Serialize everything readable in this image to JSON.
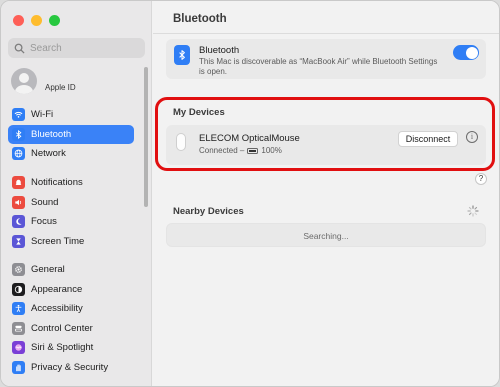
{
  "window": {
    "title": "Bluetooth",
    "traffic_lights": [
      "close",
      "minimize",
      "zoom"
    ]
  },
  "sidebar": {
    "search_placeholder": "Search",
    "profile": {
      "name": "",
      "subtitle": "Apple ID"
    },
    "groups": [
      [
        {
          "label": "Wi-Fi",
          "icon": "wifi-icon",
          "color": "#2f7ef5"
        },
        {
          "label": "Bluetooth",
          "icon": "bluetooth-icon",
          "color": "#2f7ef5",
          "active": true
        },
        {
          "label": "Network",
          "icon": "globe-icon",
          "color": "#2f7ef5"
        }
      ],
      [
        {
          "label": "Notifications",
          "icon": "bell-icon",
          "color": "#ec4b3f"
        },
        {
          "label": "Sound",
          "icon": "speaker-icon",
          "color": "#ec4b3f"
        },
        {
          "label": "Focus",
          "icon": "moon-icon",
          "color": "#5b56d6"
        },
        {
          "label": "Screen Time",
          "icon": "hourglass-icon",
          "color": "#5b56d6"
        }
      ],
      [
        {
          "label": "General",
          "icon": "gear-icon",
          "color": "#8e8e93"
        },
        {
          "label": "Appearance",
          "icon": "appearance-icon",
          "color": "#1d1d1f"
        },
        {
          "label": "Accessibility",
          "icon": "accessibility-icon",
          "color": "#2f7ef5"
        },
        {
          "label": "Control Center",
          "icon": "control-center-icon",
          "color": "#8e8e93"
        },
        {
          "label": "Siri & Spotlight",
          "icon": "siri-icon",
          "color": "#7a3fd6"
        },
        {
          "label": "Privacy & Security",
          "icon": "hand-icon",
          "color": "#2f7ef5"
        }
      ]
    ]
  },
  "main": {
    "title": "Bluetooth",
    "bluetooth_card": {
      "title": "Bluetooth",
      "description": "This Mac is discoverable as “MacBook Air” while Bluetooth Settings is open.",
      "enabled": true
    },
    "my_devices": {
      "heading": "My Devices",
      "device": {
        "name": "ELECOM OpticalMouse",
        "status_prefix": "Connected –",
        "battery": "100%",
        "disconnect_label": "Disconnect",
        "info_glyph": "i"
      }
    },
    "help_glyph": "?",
    "nearby": {
      "heading": "Nearby Devices",
      "status": "Searching..."
    }
  },
  "colors": {
    "accent": "#2f7ef5",
    "highlight": "#e10f10"
  }
}
